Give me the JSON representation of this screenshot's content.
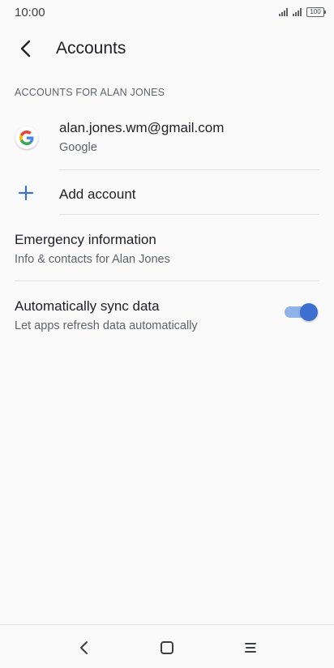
{
  "status_bar": {
    "time": "10:00",
    "battery": "100"
  },
  "app_bar": {
    "title": "Accounts"
  },
  "section": {
    "header": "ACCOUNTS FOR ALAN JONES"
  },
  "account": {
    "email": "alan.jones.wm@gmail.com",
    "provider": "Google",
    "icon": "google-icon"
  },
  "add_account": {
    "label": "Add account",
    "icon": "plus-icon"
  },
  "emergency": {
    "title": "Emergency information",
    "subtitle": "Info & contacts for Alan Jones"
  },
  "sync": {
    "title": "Automatically sync data",
    "subtitle": "Let apps refresh data automatically",
    "enabled": true
  },
  "colors": {
    "accent": "#3d6fd0",
    "accent_track": "#8fb2e8",
    "background": "#fafafa"
  }
}
